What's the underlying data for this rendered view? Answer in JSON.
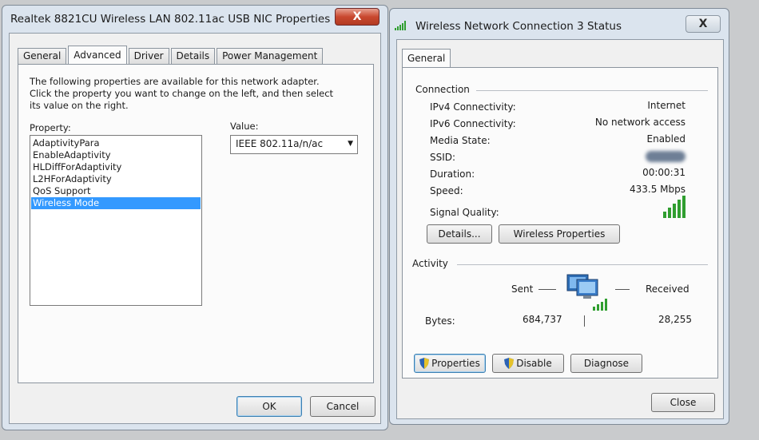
{
  "left_window": {
    "title": "Realtek 8821CU Wireless LAN 802.11ac USB NIC Properties",
    "close_glyph": "X",
    "tabs": [
      "General",
      "Advanced",
      "Driver",
      "Details",
      "Power Management"
    ],
    "active_tab": "Advanced",
    "description": "The following properties are available for this network adapter. Click the property you want to change on the left, and then select its value on the right.",
    "property_label": "Property:",
    "value_label": "Value:",
    "properties": [
      "AdaptivityPara",
      "EnableAdaptivity",
      "HLDiffForAdaptivity",
      "L2HForAdaptivity",
      "QoS Support",
      "Wireless Mode"
    ],
    "selected_property": "Wireless Mode",
    "value_selected": "IEEE 802.11a/n/ac",
    "ok_label": "OK",
    "cancel_label": "Cancel"
  },
  "right_window": {
    "title": "Wireless Network Connection 3 Status",
    "close_glyph": "X",
    "tab": "General",
    "connection_heading": "Connection",
    "fields": [
      {
        "label": "IPv4 Connectivity:",
        "value": "Internet"
      },
      {
        "label": "IPv6 Connectivity:",
        "value": "No network access"
      },
      {
        "label": "Media State:",
        "value": "Enabled"
      },
      {
        "label": "SSID:",
        "value": ""
      },
      {
        "label": "Duration:",
        "value": "00:00:31"
      },
      {
        "label": "Speed:",
        "value": "433.5 Mbps"
      }
    ],
    "signal_label": "Signal Quality:",
    "signal_bars": 5,
    "details_label": "Details...",
    "wireless_props_label": "Wireless Properties",
    "activity_heading": "Activity",
    "sent_label": "Sent",
    "received_label": "Received",
    "bytes_label": "Bytes:",
    "bytes_sent": "684,737",
    "bytes_received": "28,255",
    "properties_label": "Properties",
    "disable_label": "Disable",
    "diagnose_label": "Diagnose",
    "close_label": "Close"
  },
  "colors": {
    "selection": "#3399ff",
    "signal": "#2f9e2f",
    "close_button": "#c9482f"
  }
}
